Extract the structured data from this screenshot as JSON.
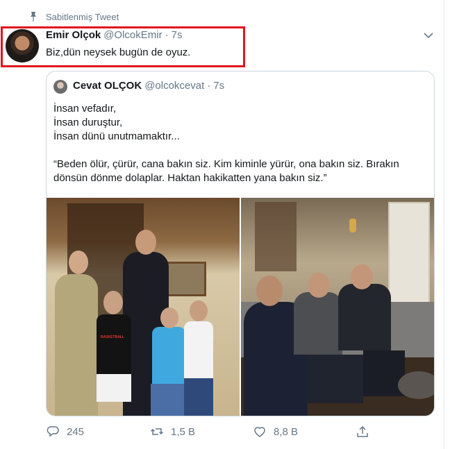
{
  "pinned_label": "Sabitlenmiş Tweet",
  "tweet": {
    "display_name": "Emir Olçok",
    "handle": "@OlcokEmir",
    "dot": "·",
    "time": "7s",
    "text": "Biz,dün neysek bugün de oyuz."
  },
  "quote": {
    "display_name": "Cevat OLÇOK",
    "handle": "@olcokcevat",
    "dot": "·",
    "time": "7s",
    "lines": [
      "İnsan vefadır,",
      "İnsan duruştur,",
      "İnsan dünü unutmamaktır...",
      "“Beden ölür, çürür, cana bakın siz. Kim kiminle yürür, ona bakın siz. Bırakın dönsün dönme dolaplar. Haktan hakikatten yana bakın siz.”"
    ],
    "photo_shirt_text": "BASKETBALL"
  },
  "actions": {
    "reply_count": "245",
    "retweet_count": "1,5 B",
    "like_count": "8,8 B"
  },
  "colors": {
    "highlight": "#e0151e",
    "muted": "#657786",
    "border": "#ccd6dd"
  }
}
